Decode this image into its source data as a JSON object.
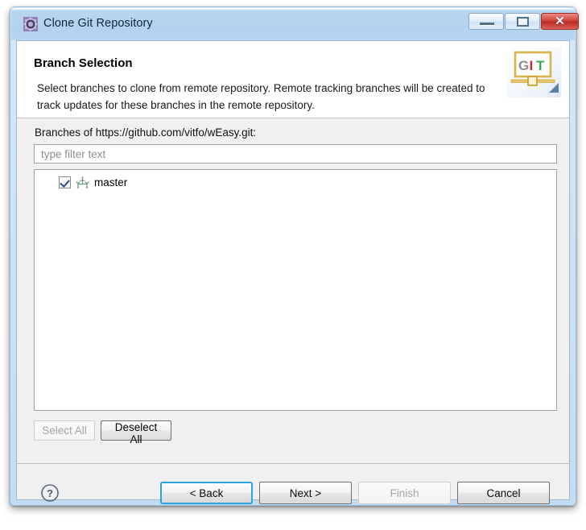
{
  "window": {
    "title": "Clone Git Repository",
    "icon": "gear-aperture-icon",
    "controls": {
      "minimize_label": "–",
      "maximize_label": "□",
      "close_label": "✕"
    }
  },
  "header": {
    "title": "Branch Selection",
    "description": "Select branches to clone from remote repository. Remote tracking branches will be created to track updates for these branches in the remote repository.",
    "logo": {
      "letter_g": "G",
      "letter_i": "I",
      "letter_t": "T"
    }
  },
  "body": {
    "branches_label": "Branches of https://github.com/vitfo/wEasy.git:",
    "filter_placeholder": "type filter text",
    "filter_value": "",
    "tree_items": [
      {
        "label": "master",
        "checked": true,
        "icon": "git-branch-icon"
      }
    ],
    "select_all_label": "Select All",
    "select_all_enabled": false,
    "deselect_all_label": "Deselect All",
    "deselect_all_enabled": true
  },
  "footer": {
    "help_label": "?",
    "back_label": "< Back",
    "next_label": "Next >",
    "finish_label": "Finish",
    "finish_enabled": false,
    "cancel_label": "Cancel"
  },
  "colors": {
    "title_bar": "#b3d2ee",
    "close_button": "#c4392f",
    "focus_border": "#2aa3e0",
    "dialog_bg": "#f0f0f0",
    "checkbox_check": "#2a4d8f"
  }
}
